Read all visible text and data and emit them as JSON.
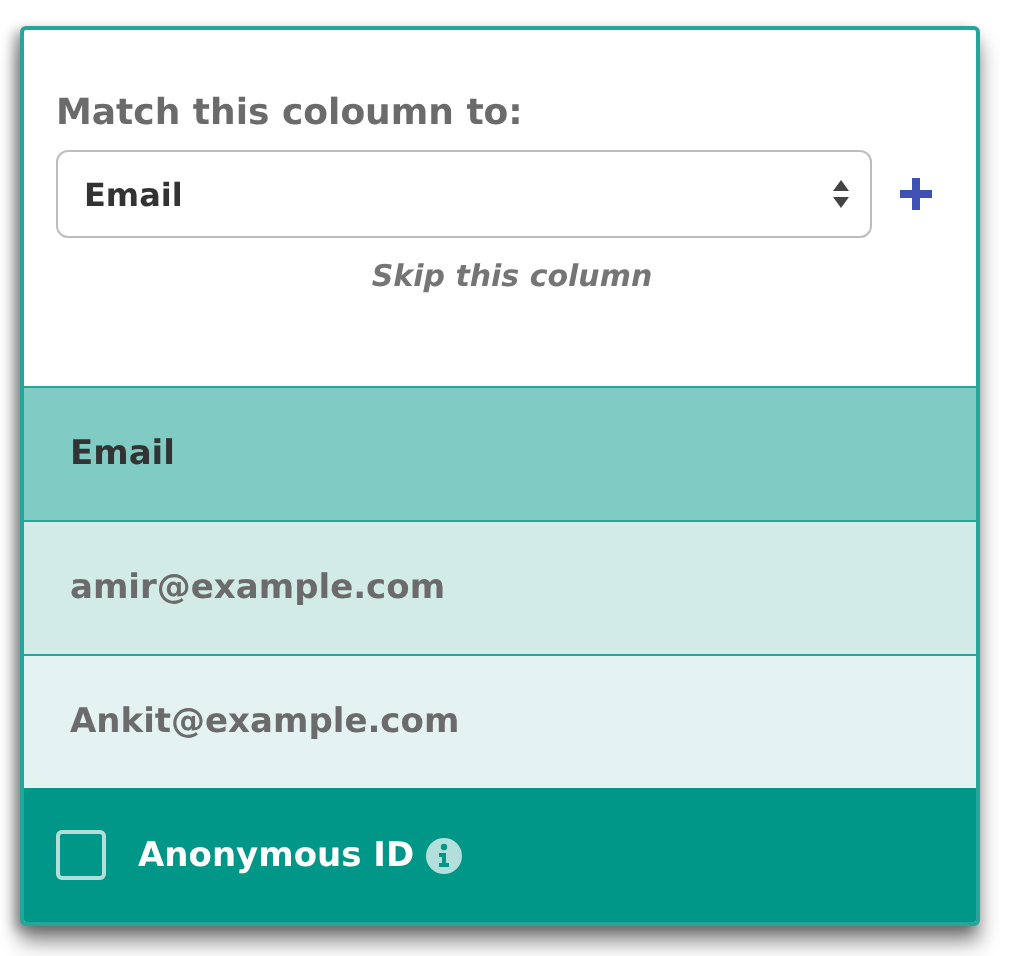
{
  "mapping": {
    "label": "Match this coloumn to:",
    "select_value": "Email",
    "skip_link": "Skip this column"
  },
  "column": {
    "header": "Email",
    "samples": [
      "amir@example.com",
      "Ankit@example.com"
    ]
  },
  "footer": {
    "checkbox_label": "Anonymous ID",
    "checked": false
  }
}
